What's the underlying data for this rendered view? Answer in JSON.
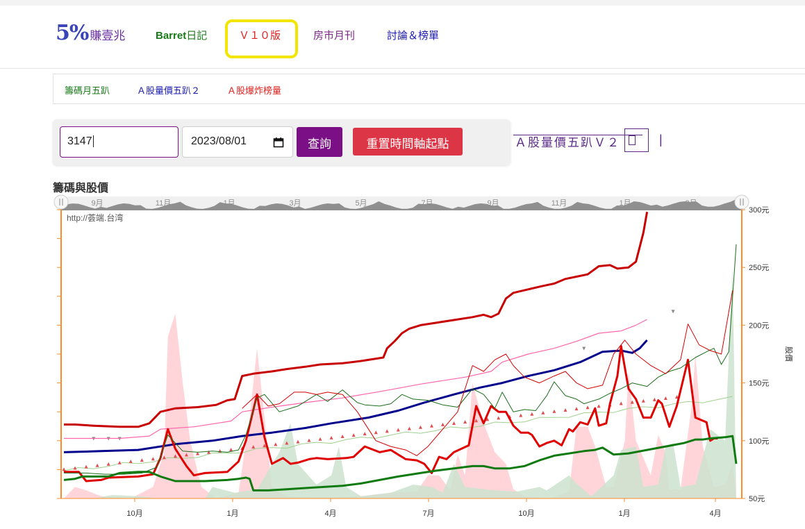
{
  "nav": {
    "logo_pct": "5%",
    "logo_text": "賺壹兆",
    "barret": "Barret",
    "barret_suffix": "日記",
    "v10": "Ｖ１０版",
    "monthly": "房市月刊",
    "discuss": "討論＆榜單"
  },
  "subnav": [
    "籌碼月五趴",
    "Ａ股量價五趴２",
    "Ａ股爆炸榜量"
  ],
  "query": {
    "stock_value": "3147",
    "date_value": "2023/08/01",
    "query_label": "查詢",
    "reset_label": "重置時間軸起點"
  },
  "side": {
    "label": "Ａ股量價五趴Ｖ２",
    "bar": "|"
  },
  "chart_title": "籌碼與股價",
  "watermark": "http://荟端.台湾",
  "colors": {
    "accent": "#7b0f85",
    "reset": "#dc3545",
    "price_red": "#e00000",
    "dark_red": "#c00000",
    "navy": "#000a8c",
    "green": "#0f7a0f"
  },
  "chart_data": {
    "type": "line",
    "title": "籌碼與股價",
    "ylabel": "股價",
    "ylim": [
      50,
      300
    ],
    "y_ticks": [
      "300元",
      "250元",
      "200元",
      "150元",
      "100元",
      "50元"
    ],
    "x_ticks": [
      "10月",
      "1月",
      "4月",
      "7月",
      "10月",
      "1月",
      "4月"
    ],
    "navigator_ticks": [
      "9月",
      "11月",
      "1月",
      "3月",
      "5月",
      "7月",
      "9月",
      "11月",
      "1月",
      "3月"
    ],
    "x_range": [
      0,
      100
    ],
    "series": [
      {
        "name": "",
        "color": "#c80000",
        "width": 3,
        "points": [
          [
            0,
            114
          ],
          [
            3,
            114
          ],
          [
            8,
            113
          ],
          [
            15,
            112
          ],
          [
            20,
            112
          ],
          [
            23,
            115
          ],
          [
            26,
            125
          ],
          [
            30,
            128
          ],
          [
            36,
            129
          ],
          [
            41,
            131
          ],
          [
            44,
            135
          ],
          [
            46,
            136
          ],
          [
            48,
            156
          ],
          [
            51,
            158
          ],
          [
            56,
            160
          ],
          [
            60,
            162
          ],
          [
            65,
            164
          ],
          [
            69,
            166
          ],
          [
            75,
            167
          ],
          [
            80,
            169
          ],
          [
            86,
            172
          ],
          [
            87,
            180
          ],
          [
            89,
            186
          ],
          [
            91,
            193
          ],
          [
            93,
            197
          ],
          [
            96,
            200
          ],
          [
            100,
            202
          ],
          [
            106,
            205
          ],
          [
            110,
            207
          ],
          [
            113,
            209
          ],
          [
            115,
            207
          ],
          [
            117,
            210
          ],
          [
            119,
            223
          ],
          [
            121,
            228
          ],
          [
            125,
            231
          ],
          [
            129,
            234
          ],
          [
            132,
            236
          ],
          [
            135,
            240
          ],
          [
            138,
            242
          ],
          [
            141,
            244
          ],
          [
            144,
            251
          ],
          [
            147,
            252
          ],
          [
            149,
            249
          ],
          [
            152,
            250
          ],
          [
            154,
            255
          ],
          [
            156,
            280
          ],
          [
            157,
            298
          ]
        ]
      },
      {
        "name": "",
        "color": "#ff66aa",
        "width": 1.2,
        "points": [
          [
            0,
            102
          ],
          [
            15,
            102
          ],
          [
            23,
            104
          ],
          [
            26,
            110
          ],
          [
            35,
            112
          ],
          [
            45,
            117
          ],
          [
            48,
            125
          ],
          [
            56,
            129
          ],
          [
            65,
            133
          ],
          [
            75,
            137
          ],
          [
            86,
            143
          ],
          [
            96,
            149
          ],
          [
            108,
            155
          ],
          [
            115,
            160
          ],
          [
            118,
            168
          ],
          [
            125,
            175
          ],
          [
            132,
            180
          ],
          [
            138,
            186
          ],
          [
            144,
            193
          ],
          [
            150,
            195
          ],
          [
            154,
            200
          ],
          [
            157,
            205
          ]
        ]
      },
      {
        "name": "",
        "color": "#00008c",
        "width": 3,
        "points": [
          [
            0,
            90
          ],
          [
            10,
            91
          ],
          [
            20,
            92
          ],
          [
            30,
            97
          ],
          [
            40,
            100
          ],
          [
            48,
            104
          ],
          [
            56,
            107
          ],
          [
            65,
            111
          ],
          [
            72,
            115
          ],
          [
            82,
            120
          ],
          [
            90,
            126
          ],
          [
            97,
            133
          ],
          [
            105,
            140
          ],
          [
            112,
            146
          ],
          [
            118,
            150
          ],
          [
            125,
            156
          ],
          [
            132,
            161
          ],
          [
            139,
            168
          ],
          [
            145,
            177
          ],
          [
            150,
            178
          ],
          [
            153,
            176
          ],
          [
            155,
            180
          ],
          [
            157,
            187
          ]
        ]
      },
      {
        "name": "",
        "color": "#e00000",
        "width": 3,
        "points": [
          [
            0,
            73
          ],
          [
            4,
            73
          ],
          [
            6,
            65
          ],
          [
            10,
            66
          ],
          [
            12,
            68
          ],
          [
            20,
            69
          ],
          [
            24,
            71
          ],
          [
            26,
            85
          ],
          [
            28,
            110
          ],
          [
            30,
            93
          ],
          [
            33,
            78
          ],
          [
            35,
            70
          ],
          [
            38,
            72
          ],
          [
            44,
            73
          ],
          [
            47,
            82
          ],
          [
            49,
            100
          ],
          [
            52,
            140
          ],
          [
            54,
            103
          ],
          [
            56,
            80
          ],
          [
            59,
            85
          ],
          [
            61,
            80
          ],
          [
            63,
            81
          ],
          [
            66,
            84
          ],
          [
            68,
            85
          ],
          [
            71,
            84
          ],
          [
            76,
            85
          ],
          [
            78,
            86
          ],
          [
            81,
            95
          ],
          [
            85,
            90
          ],
          [
            88,
            92
          ],
          [
            90,
            88
          ],
          [
            92,
            84
          ],
          [
            95,
            83
          ],
          [
            97,
            80
          ],
          [
            99,
            72
          ],
          [
            101,
            86
          ],
          [
            103,
            84
          ],
          [
            105,
            90
          ],
          [
            109,
            96
          ],
          [
            111,
            130
          ],
          [
            113,
            115
          ],
          [
            115,
            130
          ],
          [
            117,
            125
          ],
          [
            119,
            125
          ],
          [
            121,
            113
          ],
          [
            123,
            107
          ],
          [
            125,
            107
          ],
          [
            126,
            105
          ],
          [
            128,
            95
          ],
          [
            130,
            98
          ],
          [
            132,
            100
          ],
          [
            134,
            96
          ],
          [
            136,
            110
          ],
          [
            137,
            108
          ],
          [
            139,
            116
          ],
          [
            141,
            114
          ],
          [
            143,
            128
          ],
          [
            144,
            113
          ],
          [
            146,
            115
          ],
          [
            147,
            132
          ],
          [
            149,
            156
          ],
          [
            150,
            182
          ],
          [
            152,
            145
          ],
          [
            154,
            136
          ],
          [
            156,
            120
          ],
          [
            158,
            120
          ],
          [
            160,
            135
          ],
          [
            161,
            132
          ],
          [
            163,
            112
          ],
          [
            165,
            130
          ],
          [
            168,
            170
          ],
          [
            170,
            120
          ],
          [
            173,
            116
          ],
          [
            174,
            100
          ],
          [
            175,
            102
          ],
          [
            176,
            102
          ]
        ]
      },
      {
        "name": "",
        "color": "#0f7a0f",
        "width": 3,
        "points": [
          [
            0,
            66
          ],
          [
            3,
            67
          ],
          [
            5,
            69
          ],
          [
            8,
            69
          ],
          [
            12,
            69
          ],
          [
            15,
            72
          ],
          [
            20,
            73
          ],
          [
            23,
            73
          ],
          [
            26,
            69
          ],
          [
            30,
            65
          ],
          [
            38,
            65
          ],
          [
            44,
            66
          ],
          [
            47,
            67
          ],
          [
            49,
            68
          ],
          [
            50,
            67
          ],
          [
            51,
            57
          ],
          [
            55,
            57
          ],
          [
            60,
            58
          ],
          [
            65,
            59
          ],
          [
            70,
            60
          ],
          [
            75,
            61
          ],
          [
            80,
            63
          ],
          [
            85,
            66
          ],
          [
            90,
            69
          ],
          [
            96,
            72
          ],
          [
            100,
            74
          ],
          [
            105,
            76
          ],
          [
            110,
            78
          ],
          [
            113,
            78
          ],
          [
            116,
            76
          ],
          [
            120,
            76
          ],
          [
            124,
            78
          ],
          [
            128,
            83
          ],
          [
            132,
            87
          ],
          [
            136,
            89
          ],
          [
            140,
            91
          ],
          [
            143,
            92
          ],
          [
            145,
            94
          ],
          [
            148,
            88
          ],
          [
            152,
            89
          ],
          [
            157,
            92
          ],
          [
            162,
            95
          ],
          [
            167,
            98
          ],
          [
            170,
            101
          ],
          [
            172,
            101
          ],
          [
            174,
            102
          ],
          [
            178,
            103
          ],
          [
            180,
            104
          ],
          [
            181,
            80
          ]
        ]
      },
      {
        "name": "",
        "color": "#1b6e1b",
        "width": 1,
        "points": [
          [
            0,
            72
          ],
          [
            6,
            72
          ],
          [
            11,
            71
          ],
          [
            16,
            71
          ],
          [
            21,
            72
          ],
          [
            25,
            77
          ],
          [
            28,
            105
          ],
          [
            32,
            91
          ],
          [
            36,
            90
          ],
          [
            40,
            91
          ],
          [
            44,
            90
          ],
          [
            47,
            92
          ],
          [
            49,
            105
          ],
          [
            52,
            137
          ],
          [
            54,
            140
          ],
          [
            58,
            125
          ],
          [
            63,
            130
          ],
          [
            68,
            140
          ],
          [
            71,
            134
          ],
          [
            75,
            144
          ],
          [
            79,
            133
          ],
          [
            81,
            131
          ],
          [
            85,
            130
          ],
          [
            88,
            132
          ],
          [
            91,
            140
          ],
          [
            94,
            136
          ],
          [
            98,
            135
          ],
          [
            102,
            131
          ],
          [
            106,
            129
          ],
          [
            110,
            145
          ],
          [
            113,
            140
          ],
          [
            116,
            128
          ],
          [
            118,
            142
          ],
          [
            121,
            125
          ],
          [
            124,
            127
          ],
          [
            127,
            126
          ],
          [
            130,
            139
          ],
          [
            132,
            151
          ],
          [
            135,
            139
          ],
          [
            138,
            136
          ],
          [
            140,
            132
          ],
          [
            142,
            134
          ],
          [
            144,
            136
          ],
          [
            147,
            141
          ],
          [
            150,
            145
          ],
          [
            153,
            150
          ],
          [
            157,
            147
          ],
          [
            160,
            155
          ],
          [
            163,
            160
          ],
          [
            166,
            163
          ],
          [
            170,
            172
          ],
          [
            173,
            177
          ],
          [
            175,
            180
          ],
          [
            177,
            166
          ],
          [
            179,
            177
          ],
          [
            181,
            270
          ]
        ]
      },
      {
        "name": "",
        "color": "#d40000",
        "width": 1,
        "points": [
          [
            48,
            128
          ],
          [
            52,
            140
          ],
          [
            55,
            130
          ],
          [
            58,
            132
          ],
          [
            62,
            142
          ],
          [
            65,
            142
          ],
          [
            68,
            140
          ],
          [
            71,
            142
          ],
          [
            75,
            140
          ],
          [
            79,
            125
          ],
          [
            84,
            100
          ],
          [
            88,
            95
          ],
          [
            92,
            92
          ],
          [
            95,
            87
          ],
          [
            98,
            95
          ],
          [
            102,
            110
          ],
          [
            106,
            125
          ],
          [
            110,
            165
          ],
          [
            113,
            160
          ],
          [
            116,
            170
          ],
          [
            119,
            175
          ],
          [
            121,
            165
          ],
          [
            124,
            155
          ],
          [
            128,
            150
          ],
          [
            132,
            156
          ],
          [
            135,
            160
          ],
          [
            138,
            150
          ],
          [
            141,
            145
          ],
          [
            145,
            148
          ],
          [
            148,
            175
          ],
          [
            151,
            187
          ],
          [
            154,
            175
          ],
          [
            158,
            165
          ],
          [
            162,
            158
          ],
          [
            166,
            170
          ],
          [
            168,
            201
          ],
          [
            171,
            183
          ],
          [
            174,
            178
          ],
          [
            177,
            175
          ],
          [
            180,
            230
          ]
        ]
      }
    ],
    "triangles_up_color": "#e05050",
    "triangles_down_color": "#888888"
  }
}
